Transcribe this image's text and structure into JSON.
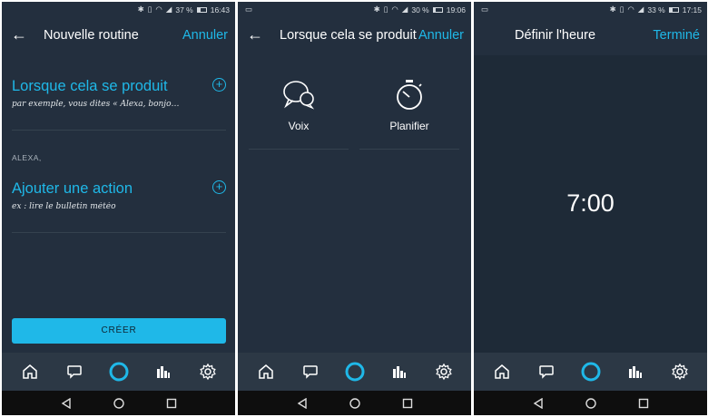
{
  "colors": {
    "accent": "#1fb8e8",
    "background": "#232f3e",
    "navbar": "#2c3845",
    "system_bar": "#0e0e0e"
  },
  "screens": [
    {
      "status": {
        "left_icon": "",
        "battery": "37 %",
        "time": "16:43",
        "battery_fill": 0.37
      },
      "header": {
        "back_icon": "back-arrow-icon",
        "title": "Nouvelle routine",
        "action": "Annuler"
      },
      "trigger_section": {
        "title": "Lorsque cela se produit",
        "subtitle": "par exemple, vous dites « Alexa, bonjo…"
      },
      "alexa_label": "ALEXA,",
      "action_section": {
        "title": "Ajouter une action",
        "subtitle": "ex : lire le bulletin météo"
      },
      "create_button": "CRÉER"
    },
    {
      "status": {
        "left_icon": "message-icon",
        "battery": "30 %",
        "time": "19:06",
        "battery_fill": 0.3
      },
      "header": {
        "back_icon": "back-arrow-icon",
        "title": "Lorsque cela se produit",
        "action": "Annuler"
      },
      "triggers": [
        {
          "label": "Voix",
          "icon": "speech-bubbles-icon"
        },
        {
          "label": "Planifier",
          "icon": "stopwatch-icon"
        }
      ]
    },
    {
      "status": {
        "left_icon": "message-icon",
        "battery": "33 %",
        "time": "17:15",
        "battery_fill": 0.33
      },
      "header": {
        "title": "Définir l'heure",
        "action": "Terminé"
      },
      "time_value": "7:00"
    }
  ],
  "bottom_nav": [
    "home-icon",
    "chat-icon",
    "alexa-ring-icon",
    "music-bars-icon",
    "settings-gear-icon"
  ],
  "system_nav": [
    "back-triangle-icon",
    "home-circle-icon",
    "recents-square-icon"
  ]
}
